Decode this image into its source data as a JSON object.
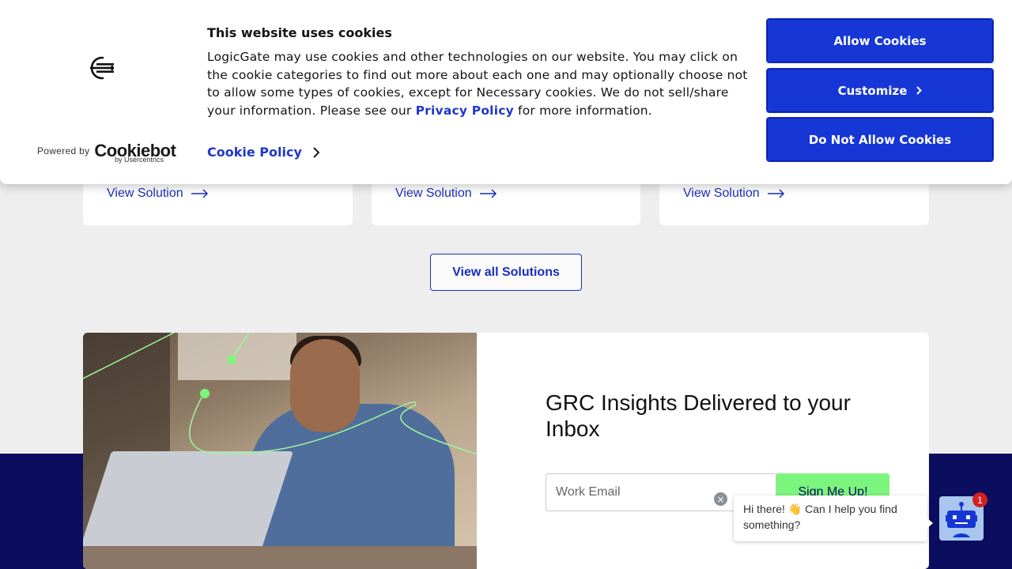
{
  "cookie_banner": {
    "title": "This website uses cookies",
    "body_prefix": "LogicGate may use cookies and other technologies on our website. You may click on the cookie categories to find out more about each one and may optionally choose not to allow some types of cookies, except for Necessary cookies.  We do not sell/share your information. Please see our ",
    "privacy_link": "Privacy Policy",
    "body_suffix": " for more information.",
    "cookie_policy_link": "Cookie Policy",
    "powered_by": "Powered by",
    "cookiebot_brand": "Cookiebot",
    "usercentrics": "by Usercentrics",
    "buttons": {
      "allow": "Allow Cookies",
      "customize": "Customize",
      "deny": "Do Not Allow Cookies"
    }
  },
  "solutions": {
    "cards": [
      {
        "link": "View Solution"
      },
      {
        "link": "View Solution"
      },
      {
        "link": "View Solution"
      }
    ],
    "view_all": "View all Solutions"
  },
  "newsletter": {
    "title": "GRC Insights Delivered to your Inbox",
    "email_placeholder": "Work Email",
    "signup_label": "Sign Me Up!"
  },
  "chat": {
    "message": "Hi there! 👋 Can I help you find something?",
    "close_symbol": "×",
    "unread_count": "1"
  },
  "colors": {
    "brand_blue": "#1636d6",
    "navy": "#0b0d5e",
    "accent_green": "#7cf57c"
  }
}
